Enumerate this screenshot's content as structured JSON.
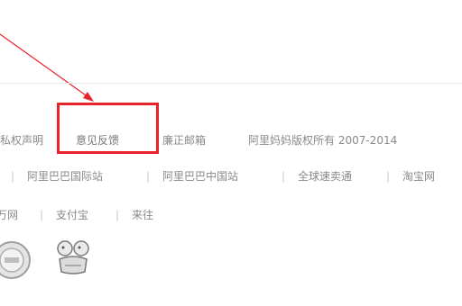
{
  "footer": {
    "row1": {
      "links": [
        "隐私权声明",
        "意见反馈",
        "廉正邮箱"
      ],
      "copyright": "阿里妈妈版权所有 2007-2014"
    },
    "row2": {
      "links": [
        "阿里巴巴国际站",
        "阿里巴巴中国站",
        "全球速卖通",
        "淘宝网"
      ]
    },
    "row3": {
      "links": [
        "万网",
        "支付宝",
        "来往"
      ]
    }
  },
  "annotation": {
    "arrow_color": "#e8232a",
    "box_color": "#e8232a"
  },
  "icons": [
    "badge-seal-icon",
    "badge-cartoon-icon"
  ]
}
